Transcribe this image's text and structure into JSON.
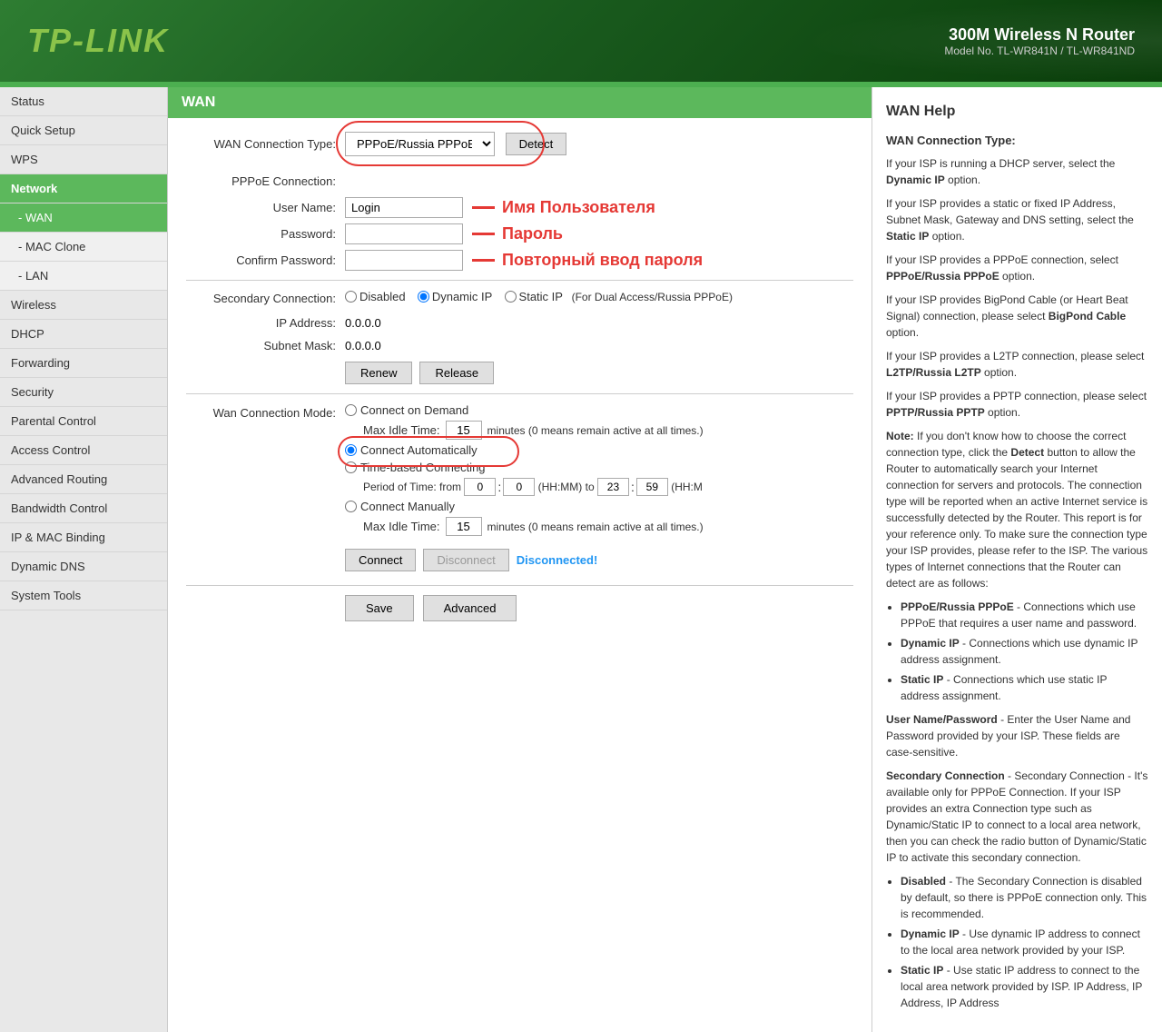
{
  "header": {
    "logo_tp": "TP-LINK",
    "product_name": "300M Wireless N Router",
    "model_number": "Model No. TL-WR841N / TL-WR841ND"
  },
  "sidebar": {
    "items": [
      {
        "id": "status",
        "label": "Status",
        "sub": false,
        "active": false
      },
      {
        "id": "quick-setup",
        "label": "Quick Setup",
        "sub": false,
        "active": false
      },
      {
        "id": "wps",
        "label": "WPS",
        "sub": false,
        "active": false
      },
      {
        "id": "network",
        "label": "Network",
        "sub": false,
        "active": true
      },
      {
        "id": "wan",
        "label": "- WAN",
        "sub": true,
        "active": true
      },
      {
        "id": "mac-clone",
        "label": "- MAC Clone",
        "sub": true,
        "active": false
      },
      {
        "id": "lan",
        "label": "- LAN",
        "sub": true,
        "active": false
      },
      {
        "id": "wireless",
        "label": "Wireless",
        "sub": false,
        "active": false
      },
      {
        "id": "dhcp",
        "label": "DHCP",
        "sub": false,
        "active": false
      },
      {
        "id": "forwarding",
        "label": "Forwarding",
        "sub": false,
        "active": false
      },
      {
        "id": "security",
        "label": "Security",
        "sub": false,
        "active": false
      },
      {
        "id": "parental-control",
        "label": "Parental Control",
        "sub": false,
        "active": false
      },
      {
        "id": "access-control",
        "label": "Access Control",
        "sub": false,
        "active": false
      },
      {
        "id": "advanced-routing",
        "label": "Advanced Routing",
        "sub": false,
        "active": false
      },
      {
        "id": "bandwidth-control",
        "label": "Bandwidth Control",
        "sub": false,
        "active": false
      },
      {
        "id": "ip-mac-binding",
        "label": "IP & MAC Binding",
        "sub": false,
        "active": false
      },
      {
        "id": "dynamic-dns",
        "label": "Dynamic DNS",
        "sub": false,
        "active": false
      },
      {
        "id": "system-tools",
        "label": "System Tools",
        "sub": false,
        "active": false
      }
    ]
  },
  "wan": {
    "section_title": "WAN",
    "connection_type_label": "WAN Connection Type:",
    "connection_type_value": "PPPoE/Russia PPPoE",
    "detect_btn": "Detect",
    "pppoe_section_label": "PPPoE Connection:",
    "username_label": "User Name:",
    "username_value": "Login",
    "username_annotation": "Имя Пользователя",
    "password_label": "Password:",
    "password_annotation": "Пароль",
    "confirm_password_label": "Confirm Password:",
    "confirm_password_annotation": "Повторный ввод пароля",
    "secondary_connection_label": "Secondary Connection:",
    "disabled_option": "Disabled",
    "dynamic_ip_option": "Dynamic IP",
    "static_ip_option": "Static IP",
    "secondary_note": "(For Dual Access/Russia PPPoE)",
    "ip_address_label": "IP Address:",
    "ip_address_value": "0.0.0.0",
    "subnet_mask_label": "Subnet Mask:",
    "subnet_mask_value": "0.0.0.0",
    "renew_btn": "Renew",
    "release_btn": "Release",
    "wan_mode_label": "Wan Connection Mode:",
    "connect_on_demand": "Connect on Demand",
    "max_idle_time_label1": "Max Idle Time:",
    "max_idle_time_value1": "15",
    "idle_note1": "minutes (0 means remain active at all times.)",
    "connect_automatically": "Connect Automatically",
    "time_based": "Time-based Connecting",
    "period_label": "Period of Time: from",
    "time_from1": "0",
    "time_from2": "0",
    "time_to_label": "(HH:MM) to",
    "time_to1": "23",
    "time_to2": "59",
    "time_to_note": "(HH:M",
    "connect_manually": "Connect Manually",
    "max_idle_time_label2": "Max Idle Time:",
    "max_idle_time_value2": "15",
    "idle_note2": "minutes (0 means remain active at all times.)",
    "connect_btn": "Connect",
    "disconnect_btn": "Disconnect",
    "disconnected_text": "Disconnected!",
    "save_btn": "Save",
    "advanced_btn": "Advanced"
  },
  "help": {
    "title": "WAN Help",
    "subtitle": "WAN Connection Type:",
    "p1": "If your ISP is running a DHCP server, select the Dynamic IP option.",
    "p2": "If your ISP provides a static or fixed IP Address, Subnet Mask, Gateway and DNS setting, select the Static IP option.",
    "p3": "If your ISP provides a PPPoE connection, select PPPoE/Russia PPPoE option.",
    "p4": "If your ISP provides BigPond Cable (or Heart Beat Signal) connection, please select BigPond Cable option.",
    "p5": "If your ISP provides a L2TP connection, please select L2TP/Russia L2TP option.",
    "p6": "If your ISP provides a PPTP connection, please select PPTP/Russia PPTP option.",
    "note": "Note: If you don't know how to choose the correct connection type, click the Detect button to allow the Router to automatically search your Internet connection for servers and protocols. The connection type will be reported when an active Internet service is successfully detected by the Router. This report is for your reference only. To make sure the connection type your ISP provides, please refer to the ISP. The various types of Internet connections that the Router can detect are as follows:",
    "bullet1_b": "PPPoE/Russia PPPoE",
    "bullet1": " - Connections which use PPPoE that requires a user name and password.",
    "bullet2_b": "Dynamic IP",
    "bullet2": " - Connections which use dynamic IP address assignment.",
    "bullet3_b": "Static IP",
    "bullet3": " - Connections which use static IP address assignment.",
    "user_pass_title": "User Name/Password",
    "user_pass_text": " - Enter the User Name and Password provided by your ISP. These fields are case-sensitive.",
    "secondary_title": "Secondary Connection",
    "secondary_text": " - Secondary Connection - It's available only for PPPoE Connection. If your ISP provides an extra Connection type such as Dynamic/Static IP to connect to a local area network, then you can check the radio button of Dynamic/Static IP to activate this secondary connection.",
    "bullet4_b": "Disabled",
    "bullet4": " - The Secondary Connection is disabled by default, so there is PPPoE connection only. This is recommended.",
    "bullet5_b": "Dynamic IP",
    "bullet5": " - Use dynamic IP address to connect to the local area network provided by your ISP.",
    "bullet6_b": "Static IP",
    "bullet6": " - Use static IP address to connect to the local area network provided by ISP. IP Address, IP Address, IP Address"
  }
}
